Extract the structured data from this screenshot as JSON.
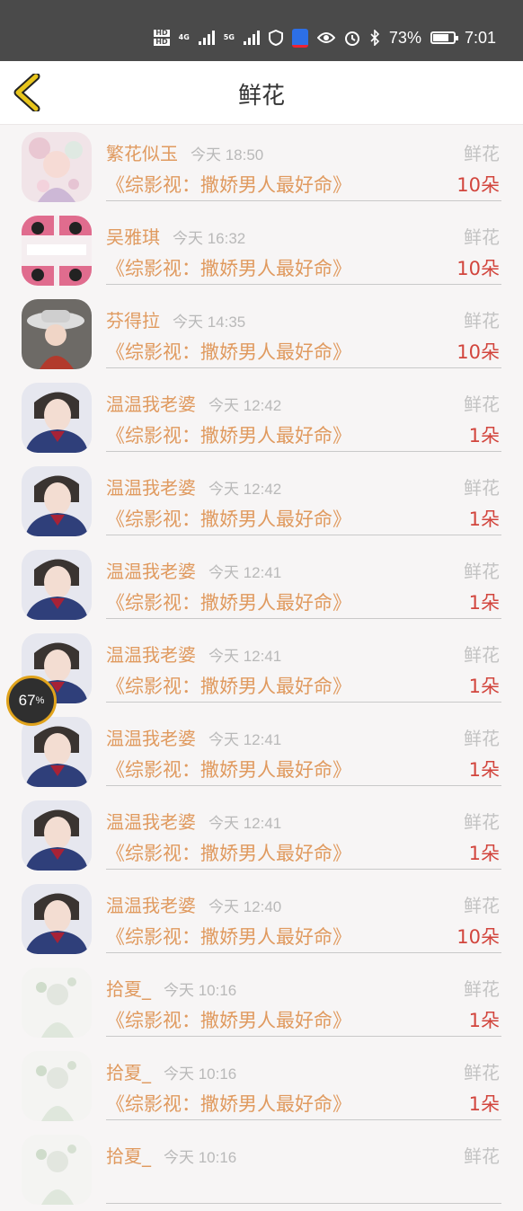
{
  "status": {
    "battery_percent": "73%",
    "time": "7:01",
    "net1": "4G",
    "net2": "5G"
  },
  "header": {
    "title": "鲜花"
  },
  "rows": [
    {
      "name": "繁花似玉",
      "time": "今天 18:50",
      "gift": "鲜花",
      "book": "《综影视：撒娇男人最好命》",
      "count": "10朵",
      "avatar": "flowers"
    },
    {
      "name": "吴雅琪",
      "time": "今天 16:32",
      "gift": "鲜花",
      "book": "《综影视：撒娇男人最好命》",
      "count": "10朵",
      "avatar": "cartoon"
    },
    {
      "name": "芬得拉",
      "time": "今天 14:35",
      "gift": "鲜花",
      "book": "《综影视：撒娇男人最好命》",
      "count": "10朵",
      "avatar": "hat"
    },
    {
      "name": "温温我老婆",
      "time": "今天 12:42",
      "gift": "鲜花",
      "book": "《综影视：撒娇男人最好命》",
      "count": "1朵",
      "avatar": "boy"
    },
    {
      "name": "温温我老婆",
      "time": "今天 12:42",
      "gift": "鲜花",
      "book": "《综影视：撒娇男人最好命》",
      "count": "1朵",
      "avatar": "boy"
    },
    {
      "name": "温温我老婆",
      "time": "今天 12:41",
      "gift": "鲜花",
      "book": "《综影视：撒娇男人最好命》",
      "count": "1朵",
      "avatar": "boy"
    },
    {
      "name": "温温我老婆",
      "time": "今天 12:41",
      "gift": "鲜花",
      "book": "《综影视：撒娇男人最好命》",
      "count": "1朵",
      "avatar": "boy"
    },
    {
      "name": "温温我老婆",
      "time": "今天 12:41",
      "gift": "鲜花",
      "book": "《综影视：撒娇男人最好命》",
      "count": "1朵",
      "avatar": "boy"
    },
    {
      "name": "温温我老婆",
      "time": "今天 12:41",
      "gift": "鲜花",
      "book": "《综影视：撒娇男人最好命》",
      "count": "1朵",
      "avatar": "boy"
    },
    {
      "name": "温温我老婆",
      "time": "今天 12:40",
      "gift": "鲜花",
      "book": "《综影视：撒娇男人最好命》",
      "count": "10朵",
      "avatar": "boy"
    },
    {
      "name": "拾夏_",
      "time": "今天 10:16",
      "gift": "鲜花",
      "book": "《综影视：撒娇男人最好命》",
      "count": "1朵",
      "avatar": "girl"
    },
    {
      "name": "拾夏_",
      "time": "今天 10:16",
      "gift": "鲜花",
      "book": "《综影视：撒娇男人最好命》",
      "count": "1朵",
      "avatar": "girl"
    },
    {
      "name": "拾夏_",
      "time": "今天 10:16",
      "gift": "鲜花",
      "book": "",
      "count": "",
      "avatar": "girl"
    }
  ],
  "overlay": {
    "progress_value": "67",
    "progress_unit": "%"
  },
  "colors": {
    "accent": "#e09a5f",
    "count": "#d2453d",
    "back": "#e8c51c",
    "statusbar": "#4a4a4a"
  }
}
